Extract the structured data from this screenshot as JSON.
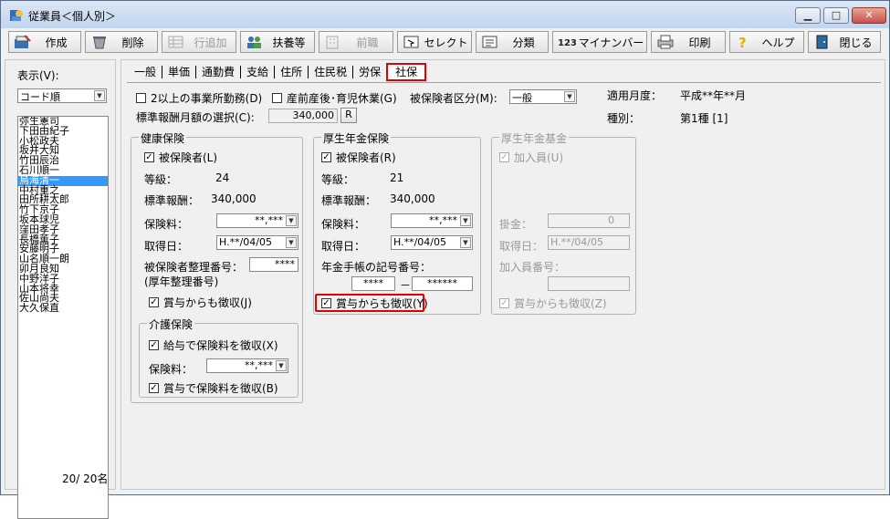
{
  "window": {
    "title": "従業員＜個人別＞"
  },
  "toolbar": {
    "create": "作成",
    "delete": "削除",
    "add_row": "行追加",
    "dependents": "扶養等",
    "previous_job": "前職",
    "select": "セレクト",
    "category": "分類",
    "my_number": "マイナンバー",
    "print": "印刷",
    "help": "ヘルプ",
    "close": "閉じる"
  },
  "left": {
    "display_label": "表示(V):",
    "sort_value": "コード順",
    "employees": [
      "弥生憲司",
      "下田由紀子",
      "小松政夫",
      "坂井大知",
      "竹田辰治",
      "石川順一",
      "烏海清一",
      "中村重之",
      "田所耕太郎",
      "竹下京子",
      "坂本球児",
      "窪田孝子",
      "長橋薫子",
      "安藤明子",
      "山名順一朗",
      "卯月良知",
      "中野洋子",
      "山本将幸",
      "佐山尚夫",
      "大久保直"
    ],
    "selected_index": 6,
    "count": "20/ 20名"
  },
  "tabs": [
    "一般",
    "単価",
    "通勤費",
    "支給",
    "住所",
    "住民税",
    "労保",
    "社保"
  ],
  "active_tab": "社保",
  "header": {
    "multi_office": "2以上の事業所勤務(D)",
    "maternity": "産前産後･育児休業(G)",
    "insured_class_label": "被保険者区分(M):",
    "insured_class_value": "一般",
    "standard_select_label": "標準報酬月額の選択(C):",
    "standard_select_value": "340,000",
    "r_button": "R",
    "applied_month_label": "適用月度：",
    "applied_month_value": "平成**年**月",
    "type_label": "種別：",
    "type_value": "第1種 [1]"
  },
  "health": {
    "title": "健康保険",
    "insured": "被保険者(L)",
    "grade_label": "等級：",
    "grade_value": "24",
    "std_label": "標準報酬：",
    "std_value": "340,000",
    "premium_label": "保険料：",
    "premium_value": "**,***",
    "acq_label": "取得日：",
    "acq_value": "H.**/04/05",
    "num_label": "被保険者整理番号：",
    "num_label2": "(厚年整理番号)",
    "num_value": "****",
    "bonus": "賞与からも徴収(J)",
    "care": {
      "title": "介護保険",
      "salary": "給与で保険料を徴収(X)",
      "premium_label": "保険料：",
      "premium_value": "**,***",
      "bonus": "賞与で保険料を徴収(B)"
    }
  },
  "pension": {
    "title": "厚生年金保険",
    "insured": "被保険者(R)",
    "grade_label": "等級：",
    "grade_value": "21",
    "std_label": "標準報酬：",
    "std_value": "340,000",
    "premium_label": "保険料：",
    "premium_value": "**,***",
    "acq_label": "取得日：",
    "acq_value": "H.**/04/05",
    "book_label": "年金手帳の記号番号：",
    "book_a": "****",
    "book_sep": "－",
    "book_b": "******",
    "bonus": "賞与からも徴収(Y)"
  },
  "fund": {
    "title": "厚生年金基金",
    "member": "加入員(U)",
    "fee_label": "掛金：",
    "fee_value": "0",
    "acq_label": "取得日：",
    "acq_value": "H.**/04/05",
    "num_label": "加入員番号：",
    "bonus": "賞与からも徴収(Z)"
  }
}
